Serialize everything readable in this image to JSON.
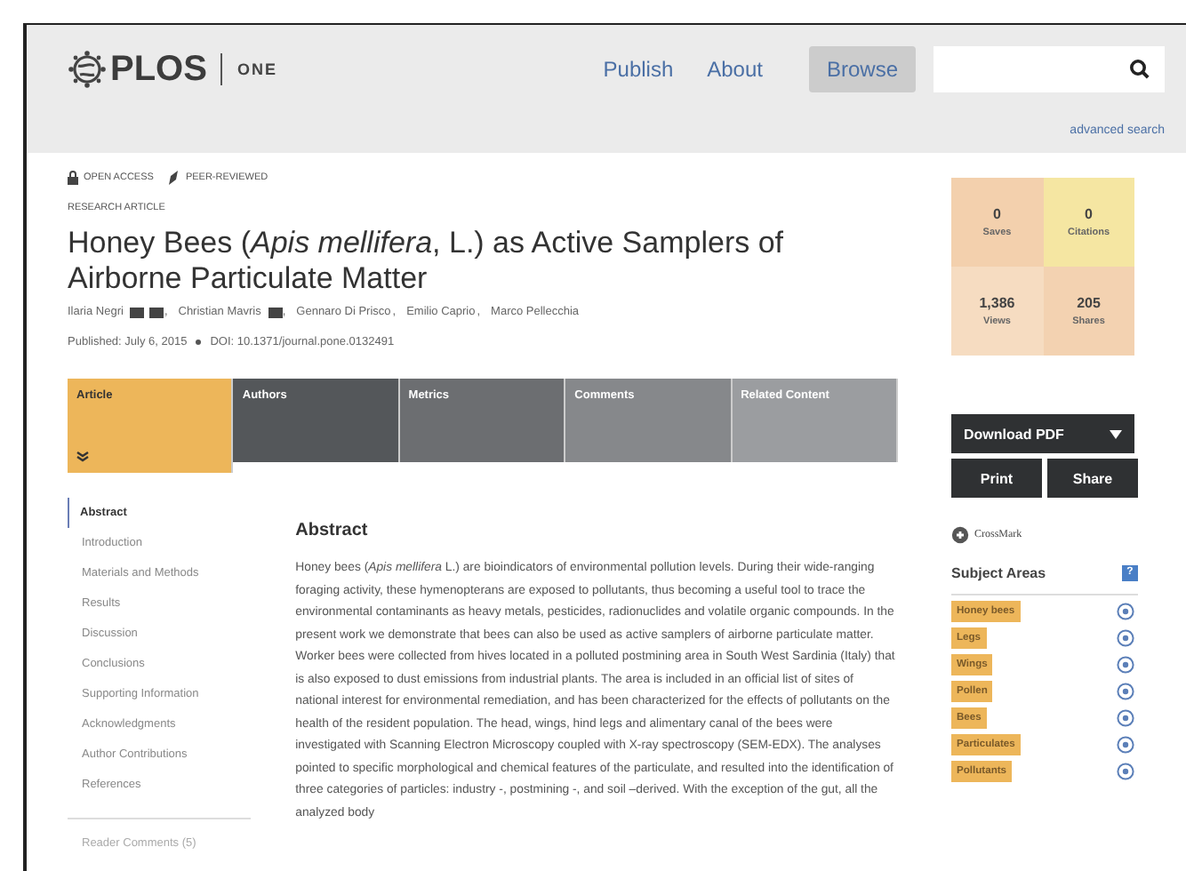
{
  "header": {
    "logo": "PLOS",
    "journal": "ONE",
    "nav": [
      {
        "label": "Publish",
        "selected": false
      },
      {
        "label": "About",
        "selected": false
      },
      {
        "label": "Browse",
        "selected": true
      }
    ],
    "search": {
      "kind": "text"
    },
    "advanced_search": "advanced search"
  },
  "article": {
    "badges": [
      {
        "kind": "lock",
        "label": "OPEN ACCESS"
      },
      {
        "kind": "review",
        "label": "PEER-REVIEWED"
      }
    ],
    "type": "RESEARCH ARTICLE",
    "title": "Honey Bees (*Apis mellifera*, L.) as Active Samplers of Airborne Particulate Matter",
    "authors": [
      {
        "name": "Ilaria Negri",
        "email": true,
        "contact": true,
        "separator": ","
      },
      {
        "name": "Christian Mavris",
        "contact": true,
        "separator": ","
      },
      {
        "name": "Gennaro Di Prisco",
        "separator": ","
      },
      {
        "name": "Emilio Caprio",
        "separator": ","
      },
      {
        "name": "Marco Pellecchia"
      }
    ],
    "published": "Published: July 6, 2015",
    "doi": "DOI: 10.1371/journal.pone.0132491"
  },
  "tabs": [
    {
      "label": "Article",
      "selected": true
    },
    {
      "label": "Authors",
      "selected": false
    },
    {
      "label": "Metrics",
      "selected": false
    },
    {
      "label": "Comments",
      "selected": false
    },
    {
      "label": "Related Content",
      "selected": false
    }
  ],
  "sections": [
    {
      "label": "Abstract",
      "selected": true
    },
    {
      "label": "Introduction",
      "selected": false
    },
    {
      "label": "Materials and Methods",
      "selected": false
    },
    {
      "label": "Results",
      "selected": false
    },
    {
      "label": "Discussion",
      "selected": false
    },
    {
      "label": "Conclusions",
      "selected": false
    },
    {
      "label": "Supporting Information",
      "selected": false
    },
    {
      "label": "Acknowledgments",
      "selected": false
    },
    {
      "label": "Author Contributions",
      "selected": false
    },
    {
      "label": "References",
      "selected": false
    }
  ],
  "reader_comments": "Reader Comments (5)",
  "abstract": {
    "heading": "Abstract",
    "text": "Honey bees (*Apis mellifera* L.) are bioindicators of environmental pollution levels. During their wide-ranging foraging activity, these hymenopterans are exposed to pollutants, thus becoming a useful tool to trace the environmental contaminants as heavy metals, pesticides, radionuclides and volatile organic compounds. In the present work we demonstrate that bees can also be used as active samplers of airborne particulate matter. Worker bees were collected from hives located in a polluted postmining area in South West Sardinia (Italy) that is also exposed to dust emissions from industrial plants. The area is included in an official list of sites of national interest for environmental remediation, and has been characterized for the effects of pollutants on the health of the resident population. The head, wings, hind legs and alimentary canal of the bees were investigated with Scanning Electron Microscopy coupled with X-ray spectroscopy (SEM-EDX). The analyses pointed to specific morphological and chemical features of the particulate, and resulted into the identification of three categories of particles: industry -, postmining -, and soil –derived. With the exception of the gut, all the analyzed body"
  },
  "metrics": [
    {
      "value": "0",
      "label": "Saves",
      "color": "#f3d0ad"
    },
    {
      "value": "0",
      "label": "Citations",
      "color": "#f5e6a2"
    },
    {
      "value": "1,386",
      "label": "Views",
      "color": "#f6dcc1"
    },
    {
      "value": "205",
      "label": "Shares",
      "color": "#f3d2b1"
    }
  ],
  "actions": {
    "download": "Download PDF",
    "print": "Print",
    "share": "Share"
  },
  "crossmark": "CrossMark",
  "subject_areas": {
    "title": "Subject Areas",
    "help": "?",
    "items": [
      "Honey bees",
      "Legs",
      "Wings",
      "Pollen",
      "Bees",
      "Particulates",
      "Pollutants"
    ]
  }
}
